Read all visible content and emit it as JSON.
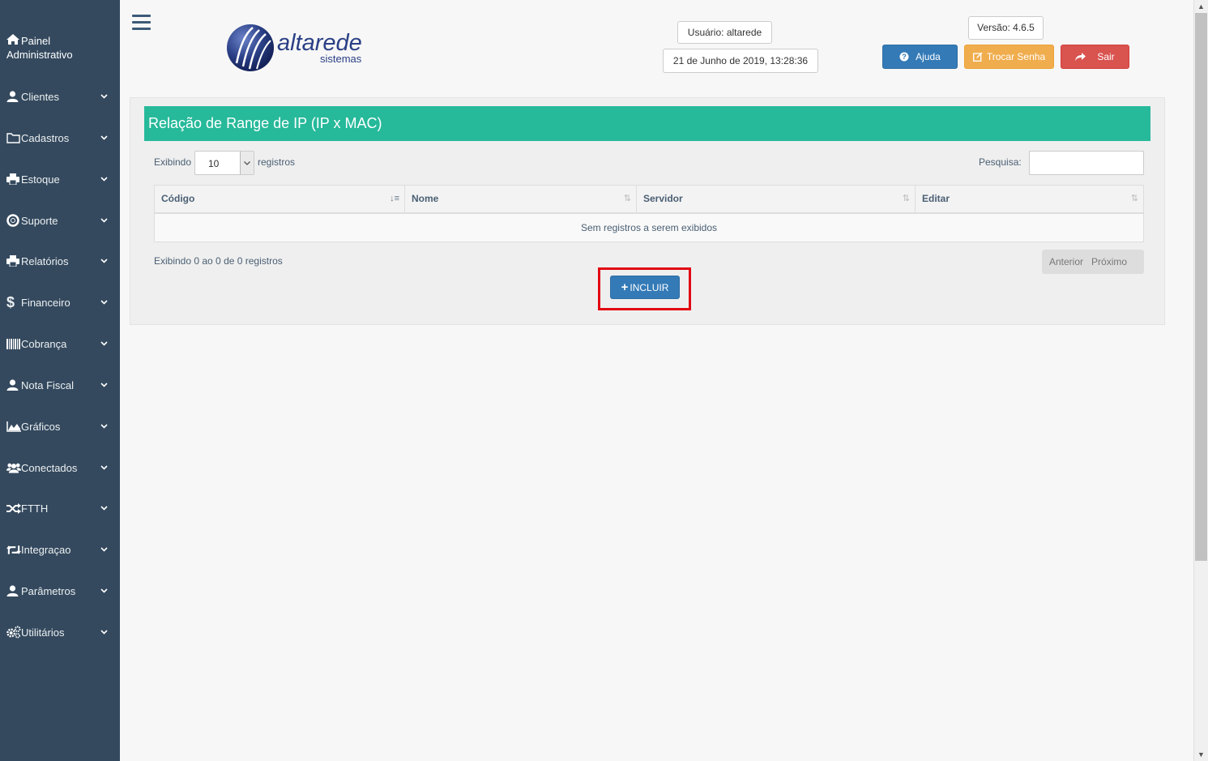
{
  "sidebar": {
    "header_line1": "Painel",
    "header_line2": "Administrativo",
    "items": [
      {
        "label": "Clientes",
        "icon": "user-icon"
      },
      {
        "label": "Cadastros",
        "icon": "folder-icon"
      },
      {
        "label": "Estoque",
        "icon": "print-icon"
      },
      {
        "label": "Suporte",
        "icon": "life-ring-icon"
      },
      {
        "label": "Relatórios",
        "icon": "print-icon"
      },
      {
        "label": "Financeiro",
        "icon": "dollar-icon"
      },
      {
        "label": "Cobrança",
        "icon": "barcode-icon"
      },
      {
        "label": "Nota Fiscal",
        "icon": "user-icon"
      },
      {
        "label": "Gráficos",
        "icon": "area-chart-icon"
      },
      {
        "label": "Conectados",
        "icon": "users-icon"
      },
      {
        "label": "FTTH",
        "icon": "random-icon"
      },
      {
        "label": "Integraçao",
        "icon": "retweet-icon"
      },
      {
        "label": "Parâmetros",
        "icon": "user-icon"
      },
      {
        "label": "Utilitários",
        "icon": "cogs-icon"
      }
    ]
  },
  "header": {
    "logo_word": "altarede",
    "logo_sub": "sistemas",
    "user": "Usuário: altarede",
    "datetime": "21 de Junho de 2019, 13:28:36",
    "version": "Versão: 4.6.5",
    "help_label": "Ajuda",
    "change_password_label": "Trocar Senha",
    "exit_label": "Sair"
  },
  "panel": {
    "title": "Relação de Range de IP (IP x MAC)",
    "length_prefix": "Exibindo",
    "length_value": "10",
    "length_suffix": "registros",
    "search_label": "Pesquisa:",
    "search_value": "",
    "columns": [
      "Código",
      "Nome",
      "Servidor",
      "Editar"
    ],
    "empty_text": "Sem registros a serem exibidos",
    "info_text": "Exibindo 0 ao 0 de 0 registros",
    "prev_label": "Anterior",
    "next_label": "Próximo",
    "add_label": "INCLUIR"
  },
  "colors": {
    "sidebar_bg": "#34495e",
    "title_bar": "#26b99a",
    "primary": "#337ab7",
    "warning": "#f0ad4e",
    "danger": "#d9534f",
    "highlight": "#e20613"
  }
}
